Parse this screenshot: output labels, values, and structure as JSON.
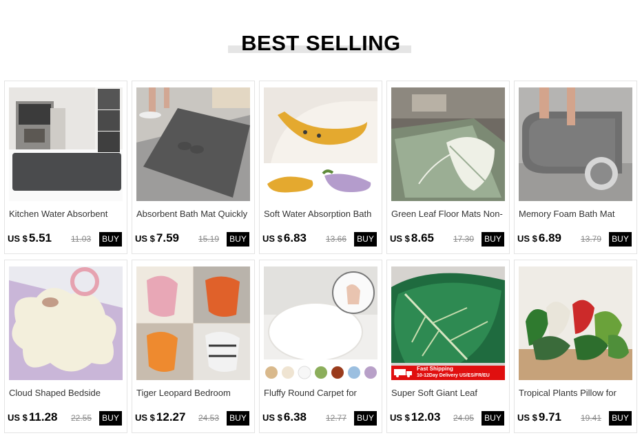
{
  "section": {
    "title": "BEST SELLING"
  },
  "products": [
    {
      "name": "Kitchen Water Absorbent",
      "currency": "US $",
      "price": "5.51",
      "old_price": "11.03",
      "buy_label": "BUY"
    },
    {
      "name": "Absorbent Bath Mat Quickly",
      "currency": "US $",
      "price": "7.59",
      "old_price": "15.19",
      "buy_label": "BUY"
    },
    {
      "name": "Soft Water Absorption Bath",
      "currency": "US $",
      "price": "6.83",
      "old_price": "13.66",
      "buy_label": "BUY"
    },
    {
      "name": "Green Leaf Floor Mats Non-",
      "currency": "US $",
      "price": "8.65",
      "old_price": "17.30",
      "buy_label": "BUY"
    },
    {
      "name": "Memory Foam Bath Mat",
      "currency": "US $",
      "price": "6.89",
      "old_price": "13.79",
      "buy_label": "BUY"
    },
    {
      "name": "Cloud Shaped Bedside",
      "currency": "US $",
      "price": "11.28",
      "old_price": "22.55",
      "buy_label": "BUY"
    },
    {
      "name": "Tiger Leopard Bedroom",
      "currency": "US $",
      "price": "12.27",
      "old_price": "24.53",
      "buy_label": "BUY"
    },
    {
      "name": "Fluffy Round Carpet for",
      "currency": "US $",
      "price": "6.38",
      "old_price": "12.77",
      "buy_label": "BUY"
    },
    {
      "name": "Super Soft Giant Leaf",
      "currency": "US $",
      "price": "12.03",
      "old_price": "24.05",
      "buy_label": "BUY",
      "badge_line1": "Fast Shipping",
      "badge_line2": "10-12Day Delivery US/ES/FR/EU"
    },
    {
      "name": "Tropical Plants Pillow for",
      "currency": "US $",
      "price": "9.71",
      "old_price": "19.41",
      "buy_label": "BUY"
    }
  ]
}
